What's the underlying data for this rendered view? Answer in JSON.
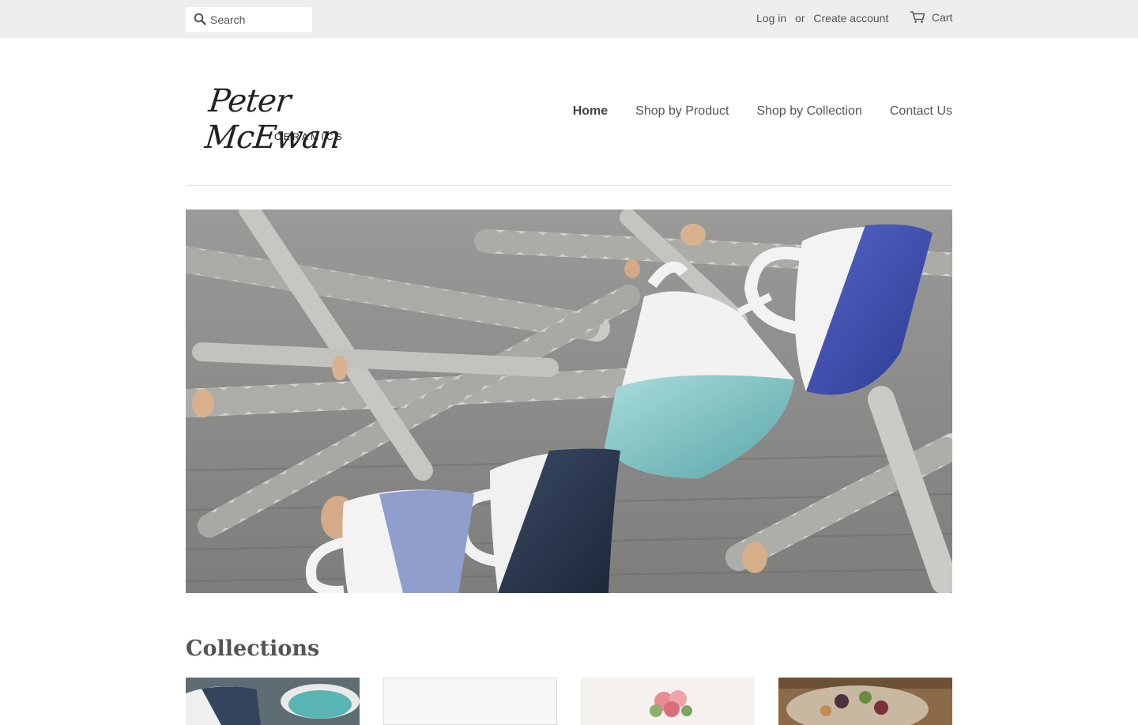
{
  "topbar": {
    "search_placeholder": "Search",
    "login_label": "Log in",
    "or_label": "or",
    "create_account_label": "Create account",
    "cart_label": "Cart"
  },
  "brand": {
    "logo_script": "Peter McEwan",
    "logo_sub": "CERAMICS"
  },
  "nav": {
    "items": [
      "Home",
      "Shop by Product",
      "Shop by Collection",
      "Contact Us"
    ],
    "active": "Home"
  },
  "collections": {
    "title": "Collections"
  },
  "colors": {
    "topbar_bg": "#eeeeee",
    "text": "#555555",
    "accent_blue": "#3f4fb0",
    "accent_teal": "#7cc2c4"
  }
}
